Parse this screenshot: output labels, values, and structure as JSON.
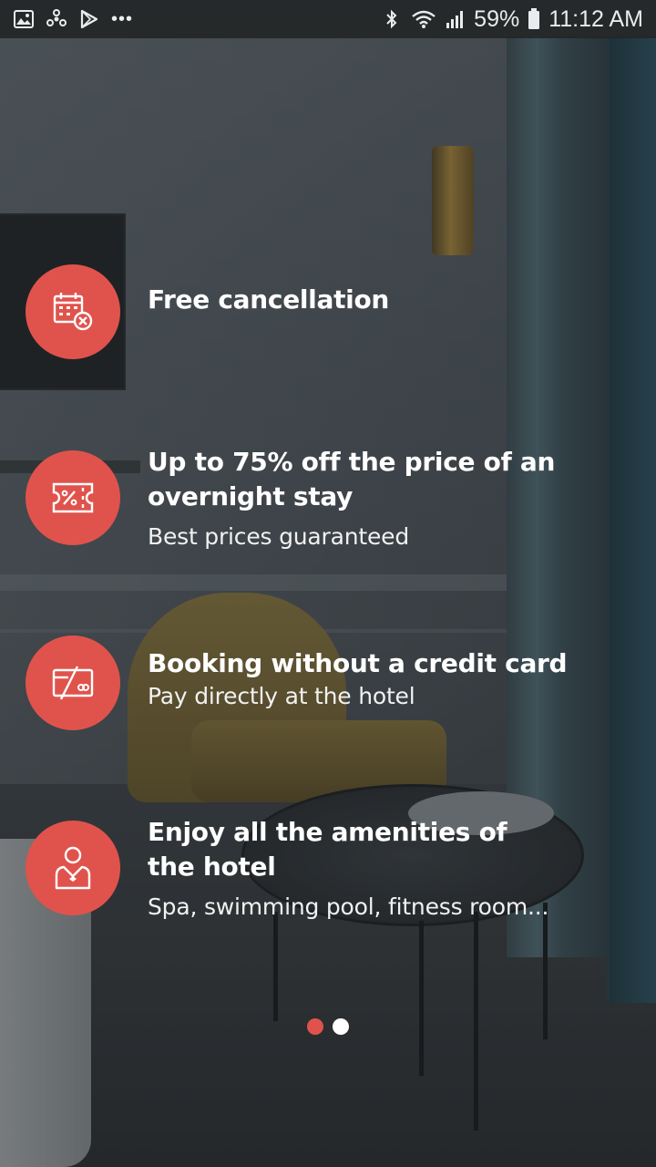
{
  "status_bar": {
    "battery_percent": "59%",
    "time": "11:12 AM",
    "overflow": "•••",
    "left_icons": [
      "image-icon",
      "fan-icon",
      "play-store-icon"
    ],
    "right_icons": [
      "bluetooth-icon",
      "wifi-icon",
      "signal-icon",
      "battery-icon"
    ]
  },
  "features": [
    {
      "icon": "calendar-cancel-icon",
      "title": "Free cancellation",
      "subtitle": ""
    },
    {
      "icon": "discount-ticket-icon",
      "title": "Up to 75% off the price of an overnight stay",
      "subtitle": "Best prices guaranteed"
    },
    {
      "icon": "no-credit-card-icon",
      "title": "Booking without a credit card",
      "subtitle": "Pay directly at the hotel"
    },
    {
      "icon": "concierge-icon",
      "title": "Enjoy all the amenities of the hotel",
      "subtitle": "Spa, swimming pool, fitness room..."
    }
  ],
  "pager": {
    "page_count": 2,
    "active_index": 0
  },
  "colors": {
    "accent": "#e0534c",
    "text": "#ffffff",
    "status_bar_bg": "#222426"
  }
}
